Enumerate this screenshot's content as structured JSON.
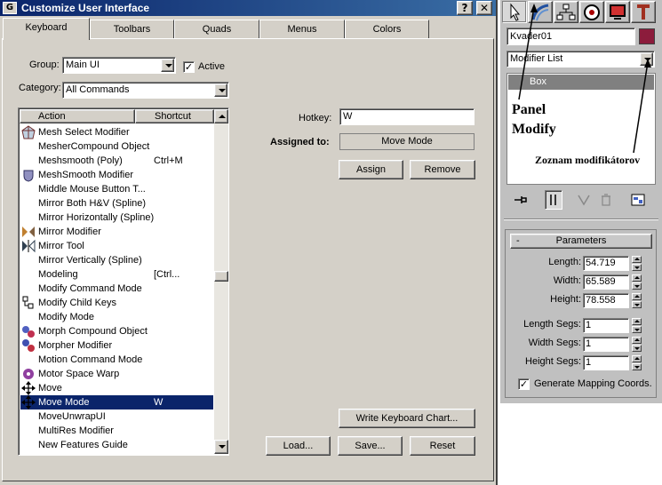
{
  "dialog": {
    "title": "Customize User Interface",
    "title_buttons": {
      "help": "?",
      "close": "✕"
    },
    "tabs": [
      {
        "label": "Keyboard",
        "active": true
      },
      {
        "label": "Toolbars"
      },
      {
        "label": "Quads"
      },
      {
        "label": "Menus"
      },
      {
        "label": "Colors"
      }
    ],
    "group_label": "Group:",
    "group_value": "Main UI",
    "active_label": "Active",
    "active_checked": true,
    "category_label": "Category:",
    "category_value": "All Commands",
    "list": {
      "col_action": "Action",
      "col_shortcut": "Shortcut",
      "rows": [
        {
          "action": "Mesh Select Modifier",
          "shortcut": "",
          "icon": "mesh-select-icon"
        },
        {
          "action": "MesherCompound Object",
          "shortcut": "",
          "icon": ""
        },
        {
          "action": "Meshsmooth (Poly)",
          "shortcut": "Ctrl+M",
          "icon": ""
        },
        {
          "action": "MeshSmooth Modifier",
          "shortcut": "",
          "icon": "meshsmooth-icon"
        },
        {
          "action": "Middle Mouse Button T...",
          "shortcut": "",
          "icon": ""
        },
        {
          "action": "Mirror Both H&V (Spline)",
          "shortcut": "",
          "icon": ""
        },
        {
          "action": "Mirror Horizontally (Spline)",
          "shortcut": "",
          "icon": ""
        },
        {
          "action": "Mirror Modifier",
          "shortcut": "",
          "icon": "mirror-modifier-icon"
        },
        {
          "action": "Mirror Tool",
          "shortcut": "",
          "icon": "mirror-tool-icon"
        },
        {
          "action": "Mirror Vertically (Spline)",
          "shortcut": "",
          "icon": ""
        },
        {
          "action": "Modeling",
          "shortcut": "[Ctrl...",
          "icon": ""
        },
        {
          "action": "Modify Command Mode",
          "shortcut": "",
          "icon": ""
        },
        {
          "action": "Modify Child Keys",
          "shortcut": "",
          "icon": "child-keys-icon"
        },
        {
          "action": "Modify Mode",
          "shortcut": "",
          "icon": ""
        },
        {
          "action": "Morph Compound Object",
          "shortcut": "",
          "icon": "morph-icon"
        },
        {
          "action": "Morpher Modifier",
          "shortcut": "",
          "icon": "morpher-icon"
        },
        {
          "action": "Motion Command Mode",
          "shortcut": "",
          "icon": ""
        },
        {
          "action": "Motor Space Warp",
          "shortcut": "",
          "icon": "motor-icon"
        },
        {
          "action": "Move",
          "shortcut": "",
          "icon": "move-icon"
        },
        {
          "action": "Move Mode",
          "shortcut": "W",
          "icon": "move-icon",
          "selected": true
        },
        {
          "action": "MoveUnwrapUI",
          "shortcut": "",
          "icon": ""
        },
        {
          "action": "MultiRes Modifier",
          "shortcut": "",
          "icon": ""
        },
        {
          "action": "New Features Guide",
          "shortcut": "",
          "icon": ""
        }
      ]
    },
    "hotkey_label": "Hotkey:",
    "hotkey_value": "W",
    "assigned_label": "Assigned to:",
    "assigned_value": "Move Mode",
    "assign_btn": "Assign",
    "remove_btn": "Remove",
    "write_chart_btn": "Write Keyboard Chart...",
    "load_btn": "Load...",
    "save_btn": "Save...",
    "reset_btn": "Reset"
  },
  "panel": {
    "tab_icons": [
      "create-icon",
      "modify-icon",
      "hierarchy-icon",
      "motion-icon",
      "display-icon",
      "utilities-icon"
    ],
    "object_name": "Kvader01",
    "object_color": "#8c1c3c",
    "modifier_list": "Modifier List",
    "stack_item": "Box",
    "annotation_panel": "Panel\nModify",
    "annotation_panel_line1": "Panel",
    "annotation_panel_line2": "Modify",
    "annotation_list": "Zoznam modifikátorov",
    "params_title": "Parameters",
    "params_collapse": "-",
    "params": [
      {
        "label": "Length:",
        "value": "54.719"
      },
      {
        "label": "Width:",
        "value": "65.589"
      },
      {
        "label": "Height:",
        "value": "78.558"
      },
      {
        "label": "Length Segs:",
        "value": "1"
      },
      {
        "label": "Width Segs:",
        "value": "1"
      },
      {
        "label": "Height Segs:",
        "value": "1"
      }
    ],
    "gen_mapping_label": "Generate Mapping Coords.",
    "gen_mapping_checked": true
  }
}
